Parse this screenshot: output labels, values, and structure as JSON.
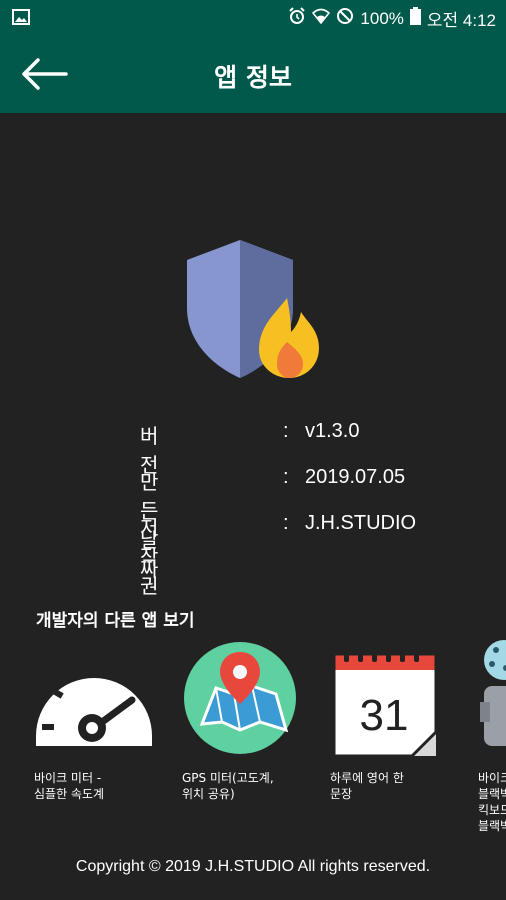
{
  "status_bar": {
    "battery": "100%",
    "time": "오전 4:12",
    "icons": [
      "image-icon",
      "alarm-icon",
      "wifi-icon",
      "do-not-disturb-icon",
      "battery-icon"
    ]
  },
  "app_bar": {
    "title": "앱 정보",
    "back_icon": "arrow-left-icon",
    "color": "#00594a"
  },
  "app_icon": "shield-fire-icon",
  "info": {
    "rows": [
      {
        "label": "버전",
        "colon": ":",
        "value": "v1.3.0"
      },
      {
        "label": "만든날짜",
        "colon": ":",
        "value": "2019.07.05"
      },
      {
        "label": "저작권",
        "colon": ":",
        "value": "J.H.STUDIO"
      }
    ]
  },
  "other_apps": {
    "title": "개발자의 다른 앱 보기",
    "apps": [
      {
        "name": "바이크 미터 -\n심플한 속도계",
        "icon": "speedometer-icon"
      },
      {
        "name": "GPS 미터(고도계,\n위치 공유)",
        "icon": "map-pin-icon"
      },
      {
        "name": "하루에 영어 한\n문장",
        "icon": "calendar-icon",
        "calendar_day": "31"
      },
      {
        "name": "바이크\n블랙박\n킥보드\n블랙박",
        "icon": "robot-icon"
      }
    ]
  },
  "copyright": "Copyright © 2019 J.H.STUDIO All rights reserved.",
  "colors": {
    "background": "#222222",
    "bar": "#00594a",
    "shield": "#7b8fcf",
    "fire": "#f6c022"
  }
}
